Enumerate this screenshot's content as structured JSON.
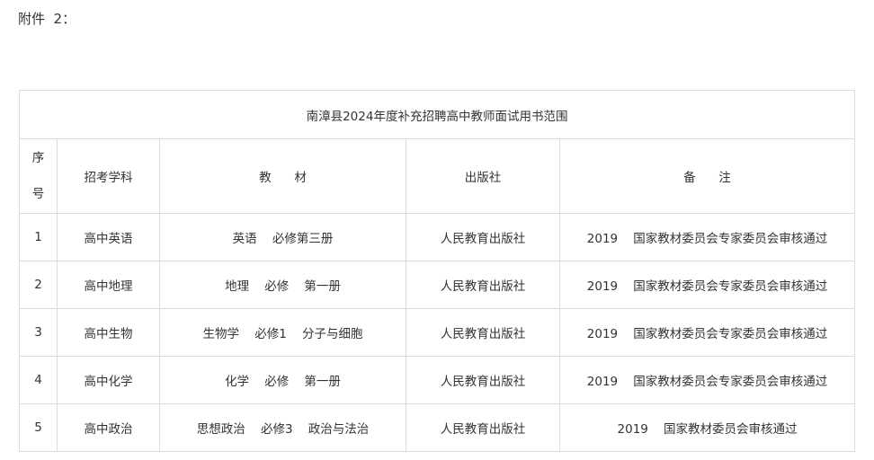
{
  "attachment_label": "附件  2：",
  "table": {
    "title": "南漳县2024年度补充招聘高中教师面试用书范围",
    "headers": {
      "seq_line1": "序",
      "seq_line2": "号",
      "subject": "招考学科",
      "textbook": "教      材",
      "publisher": "出版社",
      "remarks": "备      注"
    },
    "rows": [
      {
        "seq": "1",
        "subject": "高中英语",
        "textbook": "英语    必修第三册",
        "publisher": "人民教育出版社",
        "remarks": "2019    国家教材委员会专家委员会审核通过"
      },
      {
        "seq": "2",
        "subject": "高中地理",
        "textbook": "地理    必修    第一册",
        "publisher": "人民教育出版社",
        "remarks": "2019    国家教材委员会专家委员会审核通过"
      },
      {
        "seq": "3",
        "subject": "高中生物",
        "textbook": "生物学    必修1    分子与细胞",
        "publisher": "人民教育出版社",
        "remarks": "2019    国家教材委员会专家委员会审核通过"
      },
      {
        "seq": "4",
        "subject": "高中化学",
        "textbook": "化学    必修    第一册",
        "publisher": "人民教育出版社",
        "remarks": "2019    国家教材委员会专家委员会审核通过"
      },
      {
        "seq": "5",
        "subject": "高中政治",
        "textbook": "思想政治    必修3    政治与法治",
        "publisher": "人民教育出版社",
        "remarks": "2019    国家教材委员会审核通过"
      }
    ]
  }
}
